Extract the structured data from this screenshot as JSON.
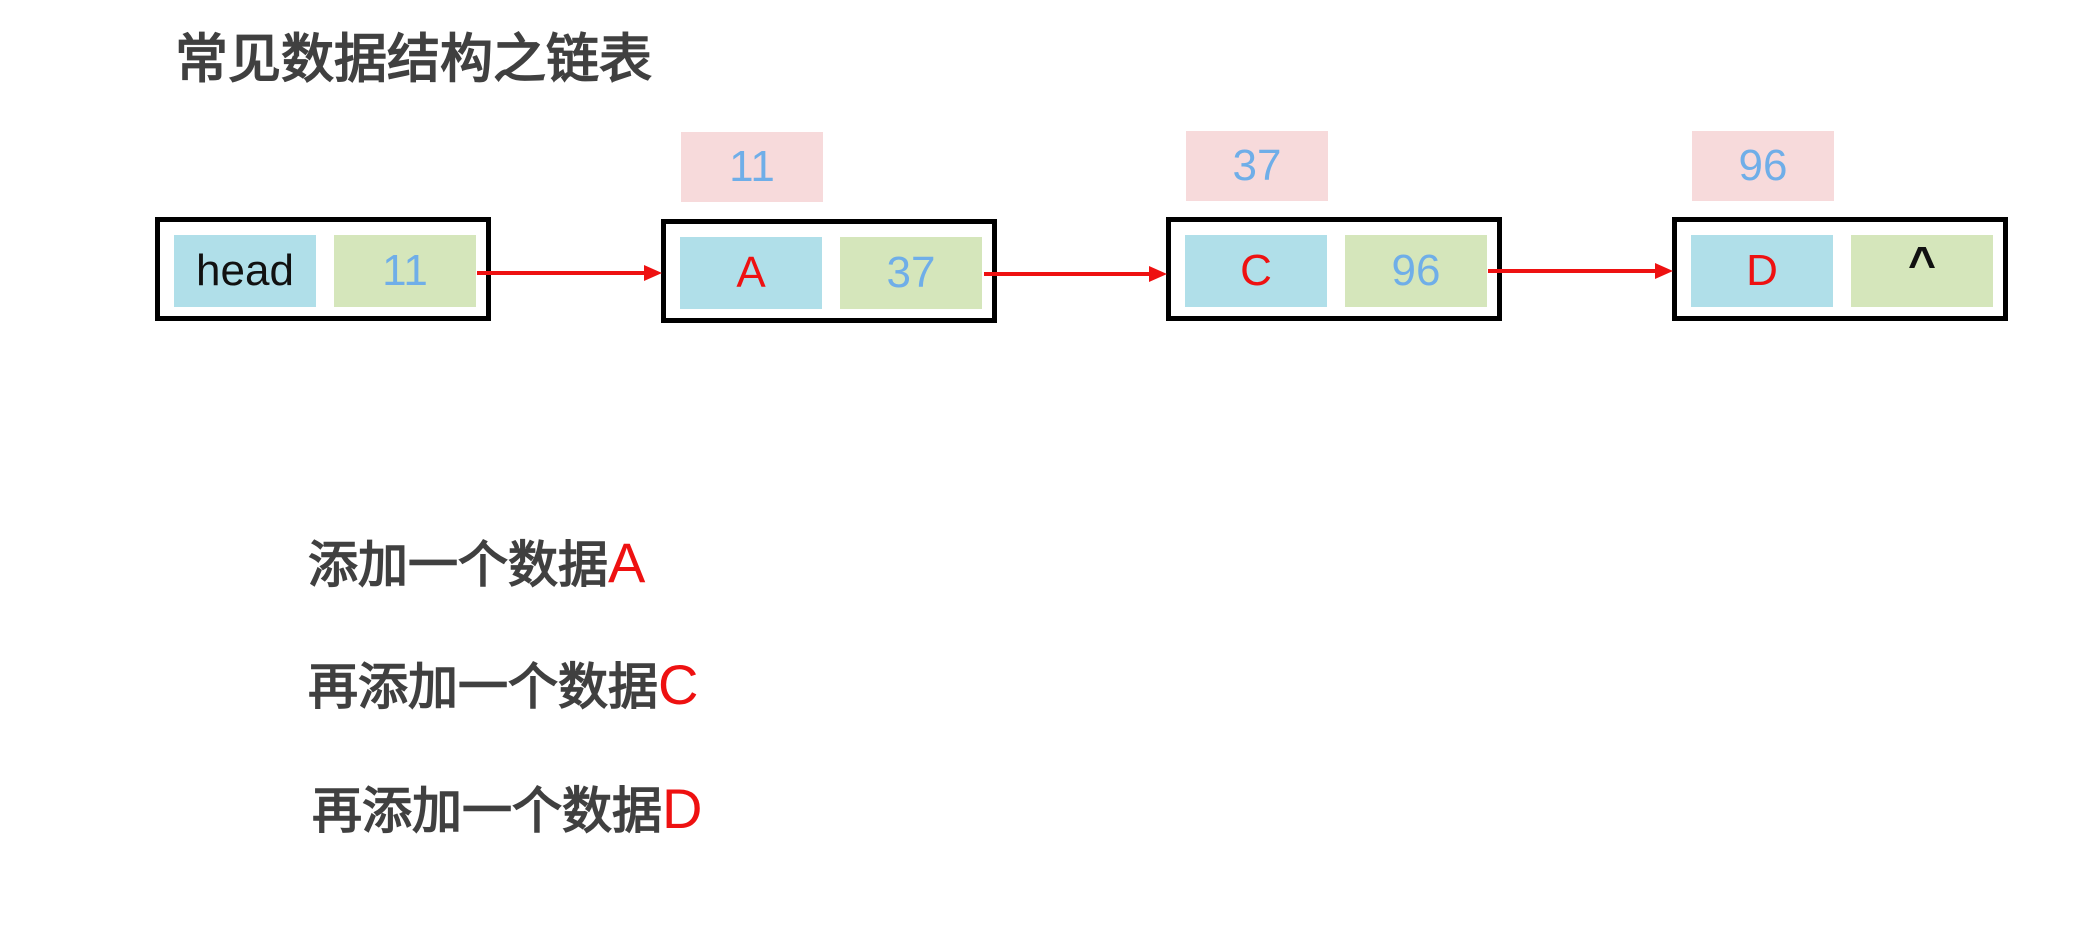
{
  "title": "常见数据结构之链表",
  "nodes": [
    {
      "data": "head",
      "next": "11",
      "address": ""
    },
    {
      "data": "A",
      "next": "37",
      "address": "11"
    },
    {
      "data": "C",
      "next": "96",
      "address": "37"
    },
    {
      "data": "D",
      "next": "^",
      "address": "96"
    }
  ],
  "steps": [
    {
      "text": "添加一个数据",
      "letter": "A"
    },
    {
      "text": "再添加一个数据",
      "letter": "C"
    },
    {
      "text": "再添加一个数据",
      "letter": "D"
    }
  ],
  "colors": {
    "data_cell": "#b0dfe9",
    "next_cell": "#d5e6bb",
    "address_box": "#f7dadb",
    "arrow": "#ee1111",
    "letter": "#ee1111",
    "address_text": "#6faee8"
  }
}
